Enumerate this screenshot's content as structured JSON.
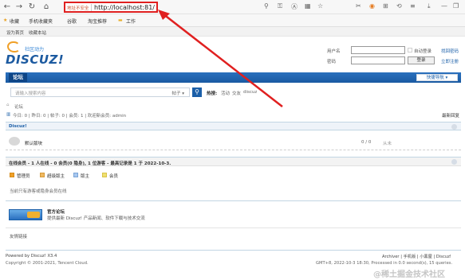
{
  "browser": {
    "address_warning": "地址不安全",
    "url": "http://localhost:81/",
    "bookmarks": [
      "收藏",
      "手机收藏夹",
      "谷歌",
      "淘宝推荐",
      "工作"
    ]
  },
  "page": {
    "topbar": {
      "left": "设为首页",
      "right": "收藏本站"
    },
    "logo": {
      "text": "DISCUZ!",
      "subtitle": "社区动力"
    },
    "login": {
      "username_label": "用户名",
      "password_label": "密码",
      "remember_label": "自动登录",
      "forgot_label": "找回密码",
      "login_button": "登录",
      "register_label": "立即注册"
    },
    "nav": {
      "forum": "论坛",
      "quick_nav": "快捷导航"
    },
    "search": {
      "placeholder": "请输入搜索内容",
      "type": "帖子",
      "hot_label": "热搜:",
      "hot_items": [
        "活动",
        "交友",
        "discuz"
      ]
    },
    "breadcrumb": "论坛",
    "stats": "今日: 0 | 昨日: 0 | 帖子: 0 | 会员: 1 | 欢迎新会员: admin",
    "latest_link": "最新回复",
    "category": {
      "name": "Discuz!",
      "forum_name": "默认版块",
      "counts": "0 / 0",
      "last": "从未"
    },
    "online": {
      "header": "在线会员 - 1 人在线 - 0 会员(0 隐身), 1 位游客 - 最高记录是 1 于 2022-10-3.",
      "legend": [
        "管理员",
        "超级版主",
        "版主",
        "会员"
      ],
      "note": "当前只有游客或隐身会员在线"
    },
    "official": {
      "title": "官方论坛",
      "desc": "提供最新 Discuz! 产品新闻、软件下载与技术交流",
      "links_label": "友情链接"
    },
    "footer": {
      "powered": "Powered by Discuz! X3.4",
      "copyright": "Copyright © 2001-2021, Tencent Cloud.",
      "links": "Archiver | 手机版 | 小黑屋 | Discuz!",
      "time": "GMT+8, 2022-10-3 18:30, Processed in 0.0 second(s), 15 queries."
    },
    "watermark": "@稀土掘金技术社区"
  },
  "colors": {
    "brand": "#1b5fa8",
    "highlight": "#e02020"
  }
}
